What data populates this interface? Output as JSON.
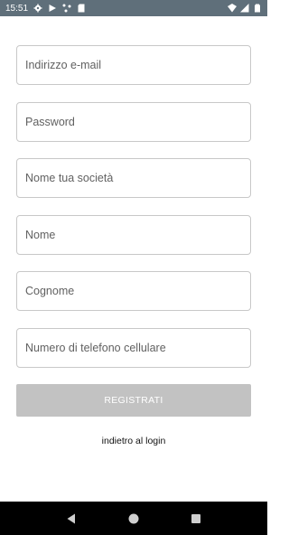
{
  "status_bar": {
    "time": "15:51",
    "icons_left": [
      "gear-icon",
      "play-store-icon",
      "network-icon",
      "sd-card-icon"
    ],
    "icons_right": [
      "wifi-icon",
      "signal-icon",
      "battery-icon"
    ]
  },
  "form": {
    "email_placeholder": "Indirizzo e-mail",
    "password_placeholder": "Password",
    "company_placeholder": "Nome tua società",
    "first_name_placeholder": "Nome",
    "last_name_placeholder": "Cognome",
    "phone_placeholder": "Numero di telefono cellulare"
  },
  "actions": {
    "register_label": "REGISTRATI",
    "back_to_login_label": "indietro al login"
  },
  "colors": {
    "status_bar": "#5f6f7a",
    "button_disabled": "#c2c2c2",
    "field_border": "#c8c8c8",
    "nav_bar": "#000000"
  },
  "nav_bar": {
    "buttons": [
      "back-icon",
      "home-icon",
      "recents-icon"
    ]
  }
}
